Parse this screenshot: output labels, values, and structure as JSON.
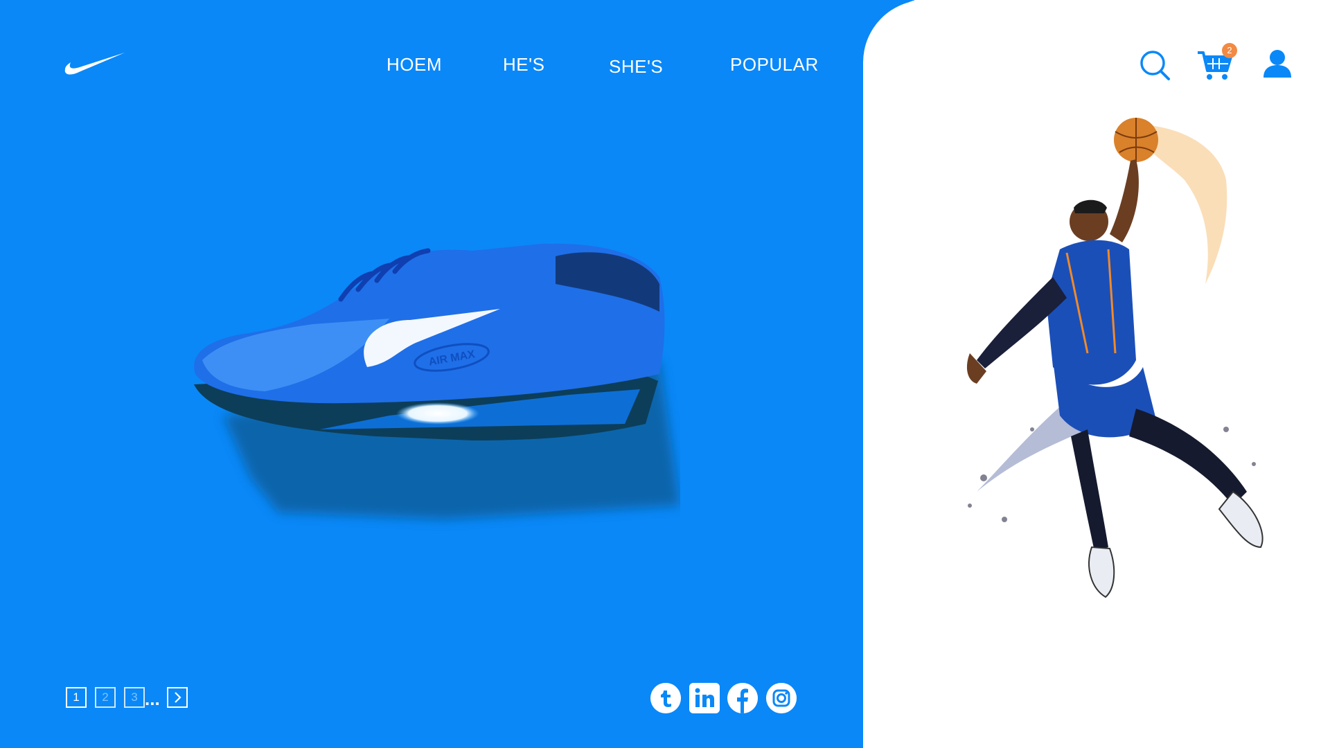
{
  "nav": {
    "items": [
      {
        "label": "HOEM"
      },
      {
        "label": "HE'S"
      },
      {
        "label": "SHE'S"
      },
      {
        "label": "POPULAR"
      }
    ]
  },
  "header_icons": {
    "search": "search-icon",
    "cart": "cart-icon",
    "cart_count": "2",
    "account": "user-icon"
  },
  "hero": {
    "shoe_badge": "AIR MAX",
    "brand_logo": "swoosh-logo"
  },
  "pagination": {
    "pages": [
      "1",
      "2",
      "3"
    ],
    "ellipsis": "...",
    "next": "chevron-right-icon"
  },
  "social": [
    "tumblr-icon",
    "linkedin-icon",
    "facebook-icon",
    "instagram-icon"
  ],
  "colors": {
    "brand_blue": "#0a88f8",
    "badge_orange": "#f18a44"
  }
}
